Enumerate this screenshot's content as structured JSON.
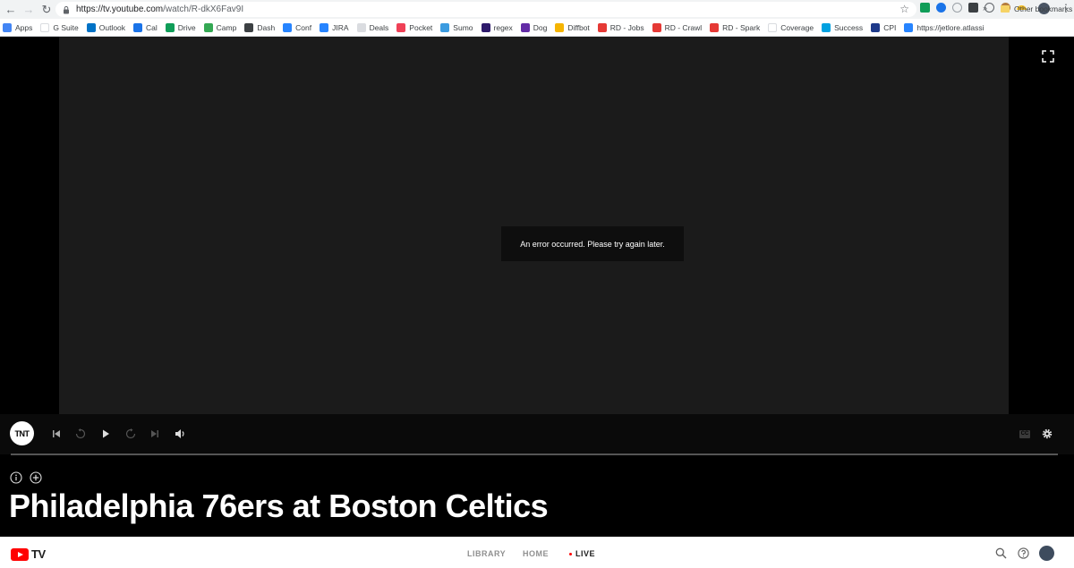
{
  "browser": {
    "url_host": "https://tv.youtube.com",
    "url_path": "/watch/R-dkX6Fav9I"
  },
  "bookmarks": [
    {
      "label": "Apps",
      "color": "#4285f4"
    },
    {
      "label": "G Suite",
      "color": "#ffffff"
    },
    {
      "label": "Outlook",
      "color": "#0072c6"
    },
    {
      "label": "Cal",
      "color": "#1a73e8"
    },
    {
      "label": "Drive",
      "color": "#0f9d58"
    },
    {
      "label": "Camp",
      "color": "#34a853"
    },
    {
      "label": "Dash",
      "color": "#3c4043"
    },
    {
      "label": "Conf",
      "color": "#2684ff"
    },
    {
      "label": "JIRA",
      "color": "#2684ff"
    },
    {
      "label": "Deals",
      "color": "#dadce0"
    },
    {
      "label": "Pocket",
      "color": "#ef4056"
    },
    {
      "label": "Sumo",
      "color": "#3b9be0"
    },
    {
      "label": "regex",
      "color": "#2e1a6b"
    },
    {
      "label": "Dog",
      "color": "#632ca6"
    },
    {
      "label": "Diffbot",
      "color": "#f5b400"
    },
    {
      "label": "RD - Jobs",
      "color": "#e53935"
    },
    {
      "label": "RD - Crawl",
      "color": "#e53935"
    },
    {
      "label": "RD - Spark",
      "color": "#e53935"
    },
    {
      "label": "Coverage",
      "color": "#ffffff"
    },
    {
      "label": "Success",
      "color": "#00a1e0"
    },
    {
      "label": "CPI",
      "color": "#1e3a8a"
    },
    {
      "label": "https://jetlore.atlassi",
      "color": "#2684ff"
    }
  ],
  "bookmarks_more": "»",
  "other_bookmarks": "Other bookmarks",
  "player": {
    "error_message": "An error occurred. Please try again later.",
    "channel_logo": "TNT",
    "cc_label": "CC",
    "title": "Philadelphia 76ers at Boston Celtics"
  },
  "ytbar": {
    "logo_text": "TV",
    "tabs": [
      {
        "label": "LIBRARY"
      },
      {
        "label": "HOME"
      },
      {
        "label": "LIVE"
      }
    ]
  },
  "colors": {
    "video_bg": "#1b1b1b",
    "youtube_red": "#ff0000",
    "live_dot": "#ff0000"
  }
}
